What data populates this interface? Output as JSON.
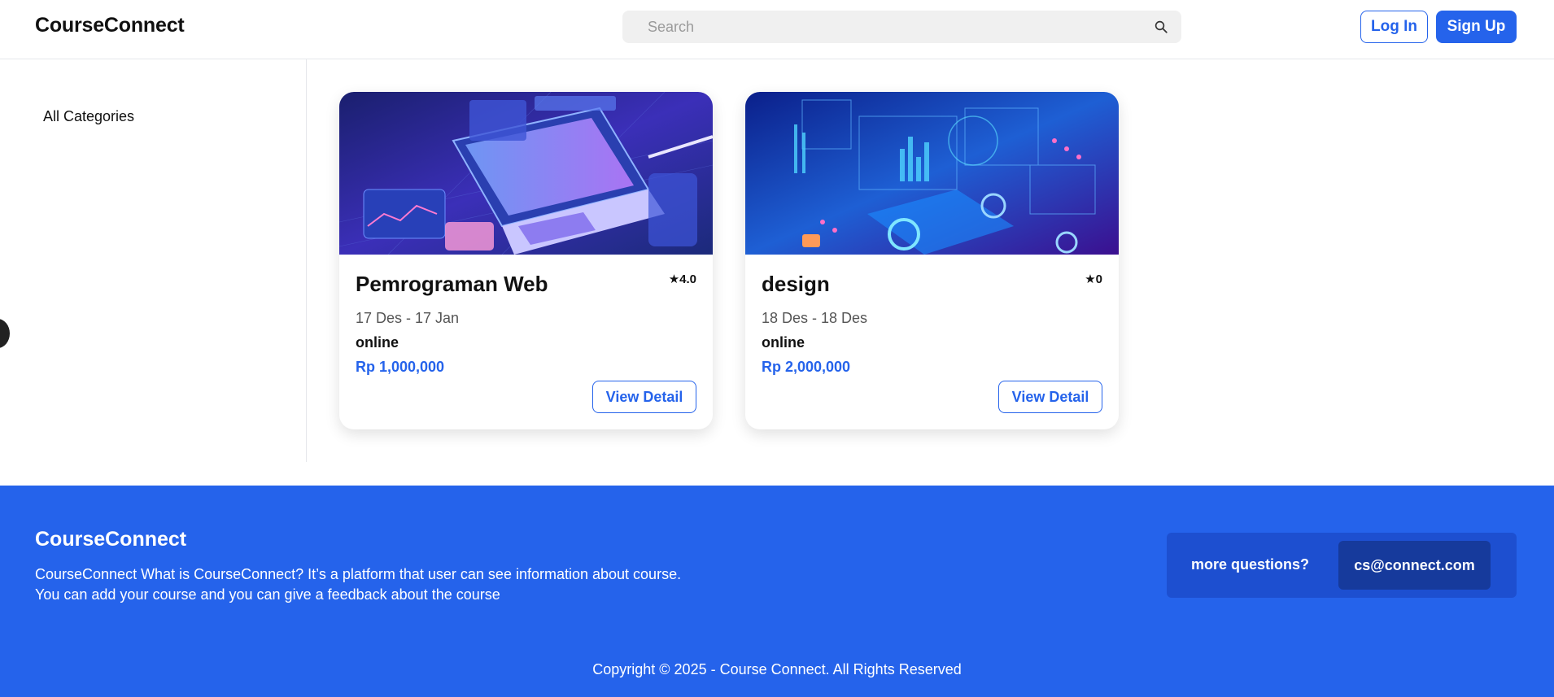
{
  "header": {
    "logo": "CourseConnect",
    "search_placeholder": "Search",
    "login_label": "Log In",
    "signup_label": "Sign Up"
  },
  "sidebar": {
    "items": [
      {
        "label": "All Categories"
      }
    ]
  },
  "courses": [
    {
      "title": "Pemrograman Web",
      "rating": "★4.0",
      "dates": "17 Des - 17 Jan",
      "mode": "online",
      "price": "Rp 1,000,000",
      "button_label": "View Detail",
      "image": "laptop-isometric-illustration"
    },
    {
      "title": "design",
      "rating": "★0",
      "dates": "18 Des - 18 Des",
      "mode": "online",
      "price": "Rp 2,000,000",
      "button_label": "View Detail",
      "image": "web-design-isometric-illustration"
    }
  ],
  "footer": {
    "brand": "CourseConnect",
    "description_line1": "CourseConnect What is CourseConnect? It’s a platform that user can see information about course.",
    "description_line2": "You can add your course and you can give a feedback about the course",
    "contact_label": "more questions?",
    "contact_email": "cs@connect.com",
    "copyright": "Copyright © 2025 - Course Connect. All Rights Reserved"
  },
  "colors": {
    "accent": "#2563eb",
    "footer_bg": "#2563eb",
    "contact_box": "#1d4fd0",
    "contact_email_bg": "#163a9c"
  }
}
